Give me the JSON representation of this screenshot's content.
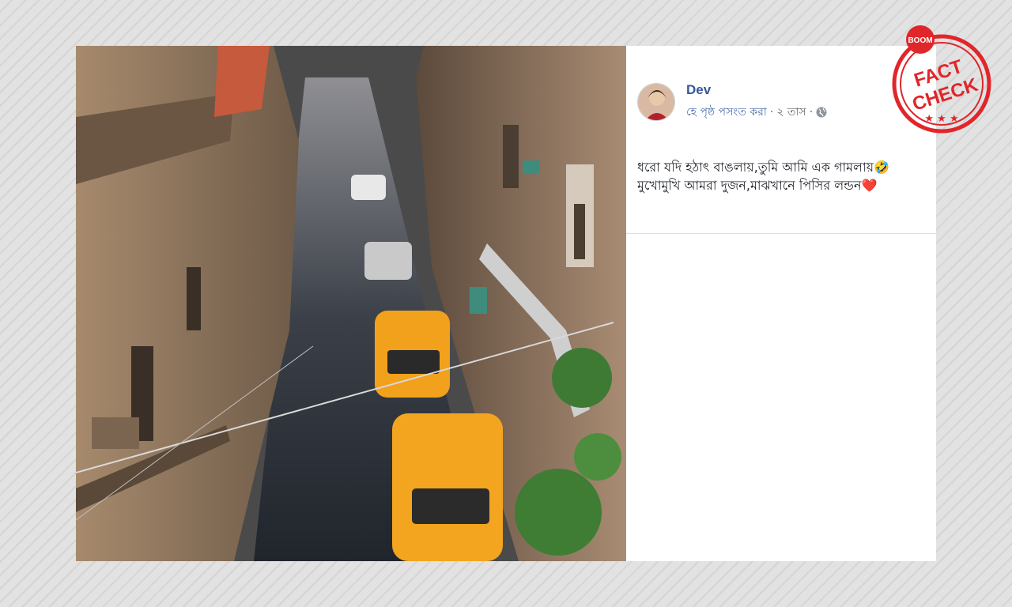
{
  "post": {
    "author": "Dev",
    "subtitle": {
      "page_label": "হে পৃষ্ঠ পসংত করা",
      "separator": "·",
      "time": "২ তাস"
    },
    "text_line1": "ধরো যদি হঠাৎ বাঙলায়,তুমি আমি এক গামলায়🤣",
    "text_line2": "মুখোমুখি আমরা দুজন,মাঝখানে পিসির লন্ডন❤️"
  },
  "stamp": {
    "brand": "BOOM",
    "line1": "FACT",
    "line2": "CHECK",
    "color": "#e0262b"
  },
  "icons": [
    "globe-icon",
    "avatar",
    "fact-check-stamp"
  ]
}
